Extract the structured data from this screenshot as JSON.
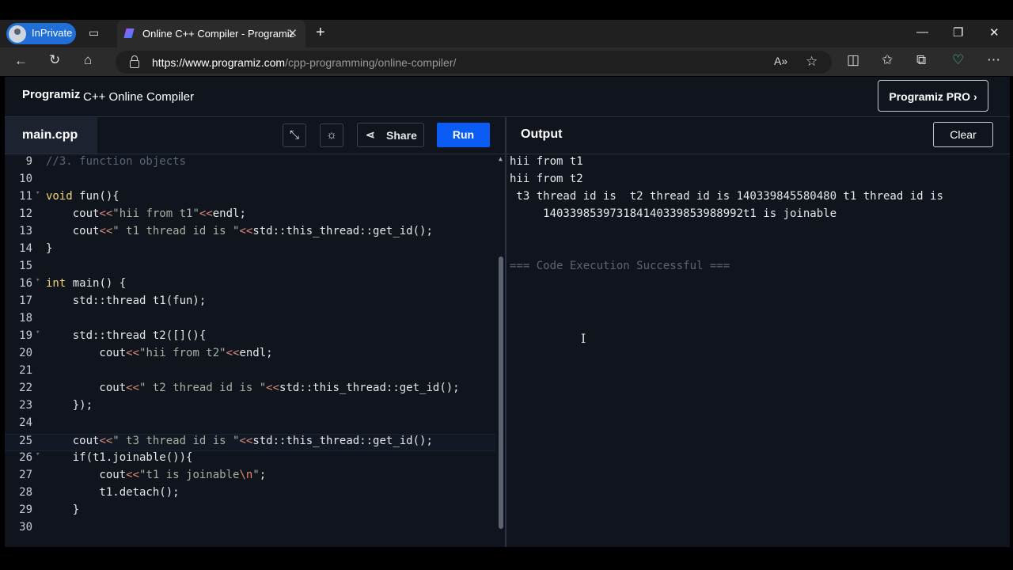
{
  "browser": {
    "profile_label": "InPrivate",
    "tab_title": "Online C++ Compiler - Programiz",
    "new_tab_icon": "+",
    "url_domain": "https://www.programiz.com",
    "url_path": "/cpp-programming/online-compiler/"
  },
  "app": {
    "logo": "Programiz",
    "title": "C++ Online Compiler",
    "pro_button": "Programiz PRO ›"
  },
  "toolbar": {
    "file_tab": "main.cpp",
    "share_label": "Share",
    "run_label": "Run"
  },
  "output_panel": {
    "title": "Output",
    "clear_label": "Clear",
    "lines": [
      "hii from t1",
      "hii from t2",
      " t3 thread id is  t2 thread id is 140339845580480 t1 thread id is",
      "     140339853973184140339853988992t1 is joinable",
      "",
      "",
      "=== Code Execution Successful ==="
    ]
  },
  "editor": {
    "lines": [
      {
        "n": "9",
        "fold": "",
        "text": "//3. function objects"
      },
      {
        "n": "10",
        "fold": "",
        "text": ""
      },
      {
        "n": "11",
        "fold": "▾",
        "text": "void fun(){"
      },
      {
        "n": "12",
        "fold": "",
        "text": "    cout<<\"hii from t1\"<<endl;"
      },
      {
        "n": "13",
        "fold": "",
        "text": "    cout<<\" t1 thread id is \"<<std::this_thread::get_id();"
      },
      {
        "n": "14",
        "fold": "",
        "text": "}"
      },
      {
        "n": "15",
        "fold": "",
        "text": ""
      },
      {
        "n": "16",
        "fold": "▾",
        "text": "int main() {"
      },
      {
        "n": "17",
        "fold": "",
        "text": "    std::thread t1(fun);"
      },
      {
        "n": "18",
        "fold": "",
        "text": ""
      },
      {
        "n": "19",
        "fold": "▾",
        "text": "    std::thread t2([](){"
      },
      {
        "n": "20",
        "fold": "",
        "text": "        cout<<\"hii from t2\"<<endl;"
      },
      {
        "n": "21",
        "fold": "",
        "text": ""
      },
      {
        "n": "22",
        "fold": "",
        "text": "        cout<<\" t2 thread id is \"<<std::this_thread::get_id();"
      },
      {
        "n": "23",
        "fold": "",
        "text": "    });"
      },
      {
        "n": "24",
        "fold": "",
        "text": ""
      },
      {
        "n": "25",
        "fold": "",
        "text": "    cout<<\" t3 thread id is \"<<std::this_thread::get_id();"
      },
      {
        "n": "26",
        "fold": "▾",
        "text": "    if(t1.joinable()){"
      },
      {
        "n": "27",
        "fold": "",
        "text": "        cout<<\"t1 is joinable\\n\";"
      },
      {
        "n": "28",
        "fold": "",
        "text": "        t1.detach();"
      },
      {
        "n": "29",
        "fold": "",
        "text": "    }"
      },
      {
        "n": "30",
        "fold": "",
        "text": ""
      }
    ],
    "current_line": "25"
  },
  "colors": {
    "run_button": "#0a5cf5",
    "keyword": "#f2d47a",
    "string": "#a7b1a0",
    "operator": "#d98b7a",
    "comment": "#5c6577"
  }
}
